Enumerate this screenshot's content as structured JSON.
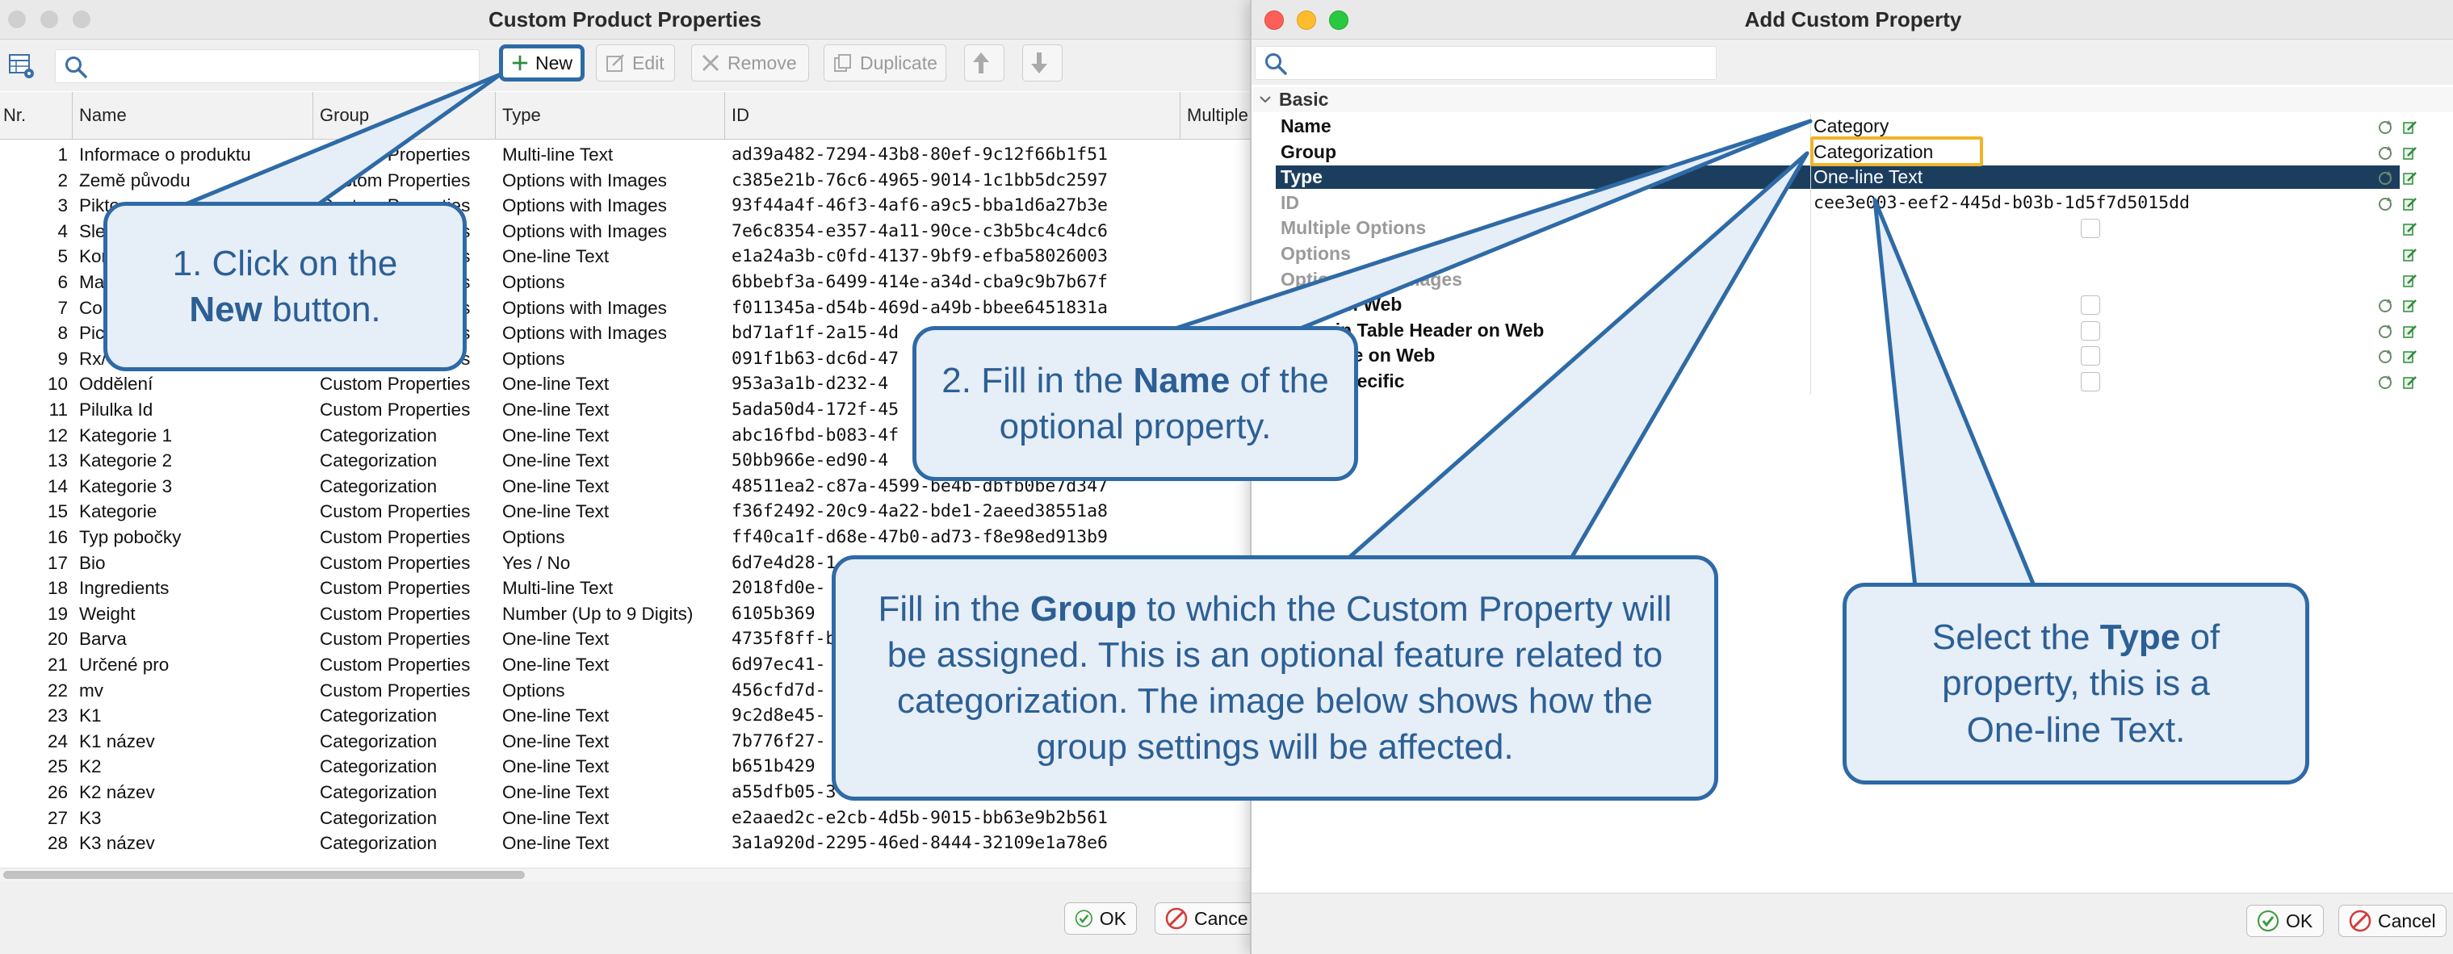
{
  "left_window": {
    "title": "Custom Product Properties",
    "search_value": "",
    "toolbar": {
      "new_label": "New",
      "edit_label": "Edit",
      "remove_label": "Remove",
      "duplicate_label": "Duplicate"
    },
    "columns": [
      "Nr.",
      "Name",
      "Group",
      "Type",
      "ID",
      "Multiple"
    ],
    "rows": [
      {
        "nr": "1",
        "name": "Informace o produktu",
        "group": "Custom Properties",
        "type": "Multi-line Text",
        "id": "ad39a482-7294-43b8-80ef-9c12f66b1f51"
      },
      {
        "nr": "2",
        "name": "Země původu",
        "group": "Custom Properties",
        "type": "Options with Images",
        "id": "c385e21b-76c6-4965-9014-1c1bb5dc2597"
      },
      {
        "nr": "3",
        "name": "Pikto",
        "group": "Custom Properties",
        "type": "Options with Images",
        "id": "93f44a4f-46f3-4af6-a9c5-bba1d6a27b3e"
      },
      {
        "nr": "4",
        "name": "Slev",
        "group": "Custom Properties",
        "type": "Options with Images",
        "id": "7e6c8354-e357-4a11-90ce-c3b5bc4c4dc6"
      },
      {
        "nr": "5",
        "name": "Kon",
        "group": "Custom Properties",
        "type": "One-line Text",
        "id": "e1a24a3b-c0fd-4137-9bf9-efba58026003"
      },
      {
        "nr": "6",
        "name": "Ma",
        "group": "Custom Properties",
        "type": "Options",
        "id": "6bbebf3a-6499-414e-a34d-cba9c9b7b67f"
      },
      {
        "nr": "7",
        "name": "Cou",
        "group": "Custom Properties",
        "type": "Options with Images",
        "id": "f011345a-d54b-469d-a49b-bbee6451831a"
      },
      {
        "nr": "8",
        "name": "Pict",
        "group": "Custom Properties",
        "type": "Options with Images",
        "id": "bd71af1f-2a15-4d"
      },
      {
        "nr": "9",
        "name": "Rx/",
        "group": "Custom Properties",
        "type": "Options",
        "id": "091f1b63-dc6d-47"
      },
      {
        "nr": "10",
        "name": "Oddělení",
        "group": "Custom Properties",
        "type": "One-line Text",
        "id": "953a3a1b-d232-4"
      },
      {
        "nr": "11",
        "name": "Pilulka Id",
        "group": "Custom Properties",
        "type": "One-line Text",
        "id": "5ada50d4-172f-45"
      },
      {
        "nr": "12",
        "name": "Kategorie 1",
        "group": "Categorization",
        "type": "One-line Text",
        "id": "abc16fbd-b083-4f"
      },
      {
        "nr": "13",
        "name": "Kategorie 2",
        "group": "Categorization",
        "type": "One-line Text",
        "id": "50bb966e-ed90-4"
      },
      {
        "nr": "14",
        "name": "Kategorie 3",
        "group": "Categorization",
        "type": "One-line Text",
        "id": "48511ea2-c87a-4599-be4b-dbfb0be7d347"
      },
      {
        "nr": "15",
        "name": "Kategorie",
        "group": "Custom Properties",
        "type": "One-line Text",
        "id": "f36f2492-20c9-4a22-bde1-2aeed38551a8"
      },
      {
        "nr": "16",
        "name": "Typ pobočky",
        "group": "Custom Properties",
        "type": "Options",
        "id": "ff40ca1f-d68e-47b0-ad73-f8e98ed913b9"
      },
      {
        "nr": "17",
        "name": "Bio",
        "group": "Custom Properties",
        "type": "Yes / No",
        "id": "6d7e4d28-1"
      },
      {
        "nr": "18",
        "name": "Ingredients",
        "group": "Custom Properties",
        "type": "Multi-line Text",
        "id": "2018fd0e-"
      },
      {
        "nr": "19",
        "name": "Weight",
        "group": "Custom Properties",
        "type": "Number (Up to 9 Digits)",
        "id": "6105b369"
      },
      {
        "nr": "20",
        "name": "Barva",
        "group": "Custom Properties",
        "type": "One-line Text",
        "id": "4735f8ff-b"
      },
      {
        "nr": "21",
        "name": "Určené pro",
        "group": "Custom Properties",
        "type": "One-line Text",
        "id": "6d97ec41-"
      },
      {
        "nr": "22",
        "name": "mv",
        "group": "Custom Properties",
        "type": "Options",
        "id": "456cfd7d-"
      },
      {
        "nr": "23",
        "name": "K1",
        "group": "Categorization",
        "type": "One-line Text",
        "id": "9c2d8e45-"
      },
      {
        "nr": "24",
        "name": "K1 název",
        "group": "Categorization",
        "type": "One-line Text",
        "id": "7b776f27-"
      },
      {
        "nr": "25",
        "name": "K2",
        "group": "Categorization",
        "type": "One-line Text",
        "id": "b651b429"
      },
      {
        "nr": "26",
        "name": "K2 název",
        "group": "Categorization",
        "type": "One-line Text",
        "id": "a55dfb05-3"
      },
      {
        "nr": "27",
        "name": "K3",
        "group": "Categorization",
        "type": "One-line Text",
        "id": "e2aaed2c-e2cb-4d5b-9015-bb63e9b2b561"
      },
      {
        "nr": "28",
        "name": "K3 název",
        "group": "Categorization",
        "type": "One-line Text",
        "id": "3a1a920d-2295-46ed-8444-32109e1a78e6"
      }
    ],
    "ok_label": "OK",
    "cancel_label": "Cance"
  },
  "right_window": {
    "title": "Add Custom Property",
    "search_value": "",
    "section_label": "Basic",
    "properties": [
      {
        "label": "Name",
        "value": "Category",
        "style": "normal"
      },
      {
        "label": "Group",
        "value": "Categorization",
        "style": "normal"
      },
      {
        "label": "Type",
        "value": "One-line Text",
        "style": "selected"
      },
      {
        "label": "ID",
        "value": "cee3e003-eef2-445d-b03b-1d5f7d5015dd",
        "style": "disabled"
      },
      {
        "label": "Multiple Options",
        "value": "",
        "style": "disabled"
      },
      {
        "label": "Options",
        "value": "",
        "style": "disabled"
      },
      {
        "label": "Options with Images",
        "value": "",
        "style": "disabled"
      },
      {
        "label": "Show on Web",
        "value": "",
        "style": "normal"
      },
      {
        "label": "Show in Table Header on Web",
        "value": "",
        "style": "normal"
      },
      {
        "label": "Filterable on Web",
        "value": "",
        "style": "normal"
      },
      {
        "label": "Store Specific",
        "value": "",
        "style": "normal"
      }
    ],
    "ok_label": "OK",
    "cancel_label": "Cancel"
  },
  "callouts": {
    "step1_prefix": "1. Click on the",
    "step1_bold": "New",
    "step1_suffix": "button.",
    "step2_prefix": "2. Fill in the",
    "step2_bold": "Name",
    "step2_suffix": "of the optional property.",
    "group_prefix": "Fill in the",
    "group_bold": "Group",
    "group_suffix": "to which the Custom Property will be assigned. This is an optional feature related to categorization. The image below shows how the group settings will be affected.",
    "type_prefix": "Select the",
    "type_bold": "Type",
    "type_suffix": "of property, this is a One-line Text."
  },
  "colors": {
    "callout_fill": "#e6eef7",
    "callout_border": "#2e6aa6",
    "callout_text": "#2c5f95",
    "selection": "#1c3e5e",
    "highlight_box": "#f0b429"
  }
}
